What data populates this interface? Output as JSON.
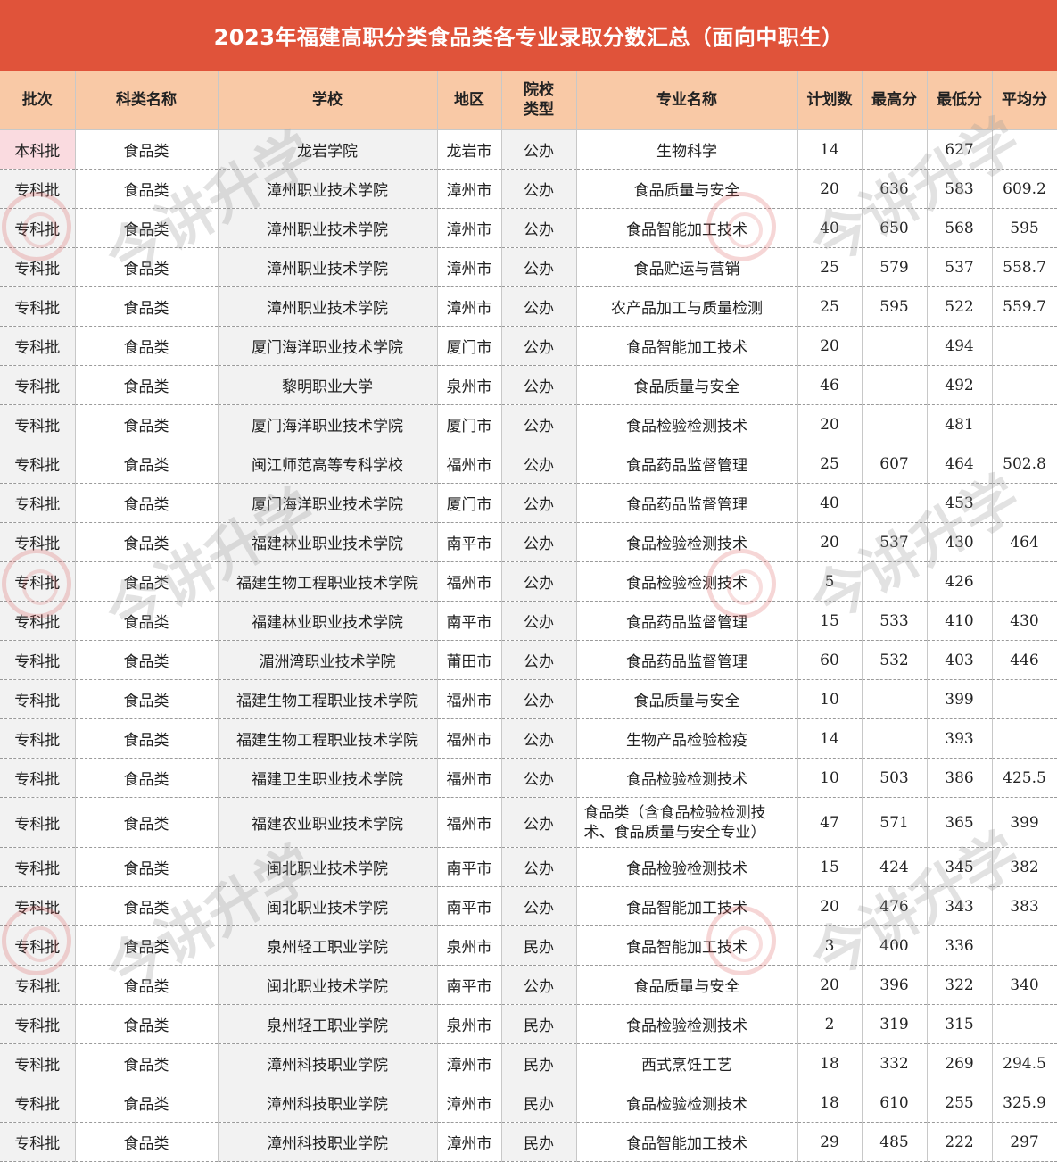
{
  "title": "2023年福建高职分类食品类各专业录取分数汇总（面向中职生）",
  "headers": [
    "批次",
    "科类名称",
    "学校",
    "地区",
    "院校\n类型",
    "专业名称",
    "计划数",
    "最高分",
    "最低分",
    "平均分"
  ],
  "rows": [
    [
      "本科批",
      "食品类",
      "龙岩学院",
      "龙岩市",
      "公办",
      "生物科学",
      "14",
      "",
      "627",
      ""
    ],
    [
      "专科批",
      "食品类",
      "漳州职业技术学院",
      "漳州市",
      "公办",
      "食品质量与安全",
      "20",
      "636",
      "583",
      "609.2"
    ],
    [
      "专科批",
      "食品类",
      "漳州职业技术学院",
      "漳州市",
      "公办",
      "食品智能加工技术",
      "40",
      "650",
      "568",
      "595"
    ],
    [
      "专科批",
      "食品类",
      "漳州职业技术学院",
      "漳州市",
      "公办",
      "食品贮运与营销",
      "25",
      "579",
      "537",
      "558.7"
    ],
    [
      "专科批",
      "食品类",
      "漳州职业技术学院",
      "漳州市",
      "公办",
      "农产品加工与质量检测",
      "25",
      "595",
      "522",
      "559.7"
    ],
    [
      "专科批",
      "食品类",
      "厦门海洋职业技术学院",
      "厦门市",
      "公办",
      "食品智能加工技术",
      "20",
      "",
      "494",
      ""
    ],
    [
      "专科批",
      "食品类",
      "黎明职业大学",
      "泉州市",
      "公办",
      "食品质量与安全",
      "46",
      "",
      "492",
      ""
    ],
    [
      "专科批",
      "食品类",
      "厦门海洋职业技术学院",
      "厦门市",
      "公办",
      "食品检验检测技术",
      "20",
      "",
      "481",
      ""
    ],
    [
      "专科批",
      "食品类",
      "闽江师范高等专科学校",
      "福州市",
      "公办",
      "食品药品监督管理",
      "25",
      "607",
      "464",
      "502.8"
    ],
    [
      "专科批",
      "食品类",
      "厦门海洋职业技术学院",
      "厦门市",
      "公办",
      "食品药品监督管理",
      "40",
      "",
      "453",
      ""
    ],
    [
      "专科批",
      "食品类",
      "福建林业职业技术学院",
      "南平市",
      "公办",
      "食品检验检测技术",
      "20",
      "537",
      "430",
      "464"
    ],
    [
      "专科批",
      "食品类",
      "福建生物工程职业技术学院",
      "福州市",
      "公办",
      "食品检验检测技术",
      "5",
      "",
      "426",
      ""
    ],
    [
      "专科批",
      "食品类",
      "福建林业职业技术学院",
      "南平市",
      "公办",
      "食品药品监督管理",
      "15",
      "533",
      "410",
      "430"
    ],
    [
      "专科批",
      "食品类",
      "湄洲湾职业技术学院",
      "莆田市",
      "公办",
      "食品药品监督管理",
      "60",
      "532",
      "403",
      "446"
    ],
    [
      "专科批",
      "食品类",
      "福建生物工程职业技术学院",
      "福州市",
      "公办",
      "食品质量与安全",
      "10",
      "",
      "399",
      ""
    ],
    [
      "专科批",
      "食品类",
      "福建生物工程职业技术学院",
      "福州市",
      "公办",
      "生物产品检验检疫",
      "14",
      "",
      "393",
      ""
    ],
    [
      "专科批",
      "食品类",
      "福建卫生职业技术学院",
      "福州市",
      "公办",
      "食品检验检测技术",
      "10",
      "503",
      "386",
      "425.5"
    ],
    [
      "专科批",
      "食品类",
      "福建农业职业技术学院",
      "福州市",
      "公办",
      "食品类（含食品检验检测技术、食品质量与安全专业）",
      "47",
      "571",
      "365",
      "399"
    ],
    [
      "专科批",
      "食品类",
      "闽北职业技术学院",
      "南平市",
      "公办",
      "食品检验检测技术",
      "15",
      "424",
      "345",
      "382"
    ],
    [
      "专科批",
      "食品类",
      "闽北职业技术学院",
      "南平市",
      "公办",
      "食品智能加工技术",
      "20",
      "476",
      "343",
      "383"
    ],
    [
      "专科批",
      "食品类",
      "泉州轻工职业学院",
      "泉州市",
      "民办",
      "食品智能加工技术",
      "3",
      "400",
      "336",
      ""
    ],
    [
      "专科批",
      "食品类",
      "闽北职业技术学院",
      "南平市",
      "公办",
      "食品质量与安全",
      "20",
      "396",
      "322",
      "340"
    ],
    [
      "专科批",
      "食品类",
      "泉州轻工职业学院",
      "泉州市",
      "民办",
      "食品检验检测技术",
      "2",
      "319",
      "315",
      ""
    ],
    [
      "专科批",
      "食品类",
      "漳州科技职业学院",
      "漳州市",
      "民办",
      "西式烹饪工艺",
      "18",
      "332",
      "269",
      "294.5"
    ],
    [
      "专科批",
      "食品类",
      "漳州科技职业学院",
      "漳州市",
      "民办",
      "食品检验检测技术",
      "18",
      "610",
      "255",
      "325.9"
    ],
    [
      "专科批",
      "食品类",
      "漳州科技职业学院",
      "漳州市",
      "民办",
      "食品智能加工技术",
      "29",
      "485",
      "222",
      "297"
    ]
  ],
  "watermark": {
    "text": "今讲升学",
    "seal_icon": "seal-icon"
  },
  "colors": {
    "title_bg": "#e0533a",
    "header_bg": "#f9c9a6",
    "shaded_col": "#f2f2f2",
    "highlight": "#fadbe0"
  }
}
